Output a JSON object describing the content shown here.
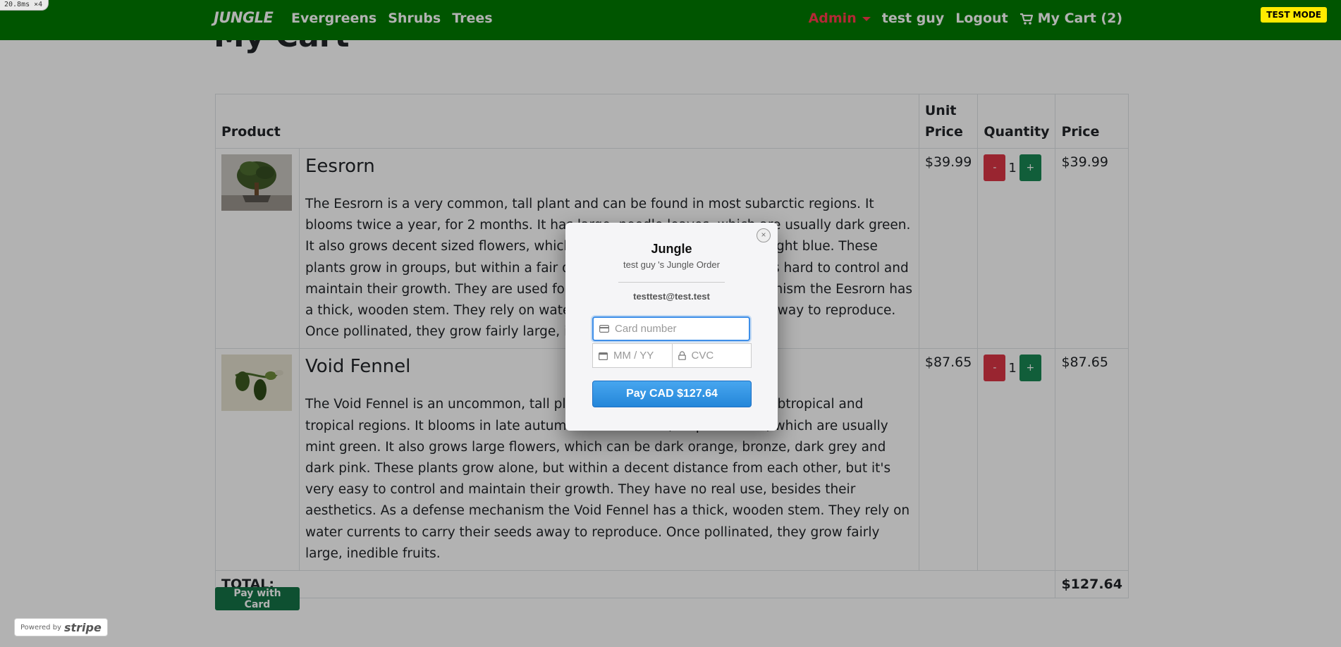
{
  "debug": {
    "perf": "20.8ms ×4"
  },
  "nav": {
    "brand": "JUNGLE",
    "left": [
      "Evergreens",
      "Shrubs",
      "Trees"
    ],
    "admin": "Admin",
    "user": "test guy",
    "logout": "Logout",
    "cart": "My Cart (2)",
    "test_mode": "TEST MODE"
  },
  "page": {
    "title": "My Cart"
  },
  "table": {
    "headers": {
      "product": "Product",
      "unit_price": "Unit Price",
      "quantity": "Quantity",
      "price": "Price"
    },
    "rows": [
      {
        "name": "Eesrorn",
        "description": "The Eesrorn is a very common, tall plant and can be found in most subarctic regions. It blooms twice a year, for 2 months. It has large, needle leaves, which are usually dark green. It also grows decent sized flowers, which can be light grey, yellow and light blue. These plants grow in groups, but within a fair distance from each other, but it's hard to control and maintain their growth. They are used for medicine. As a defense mechanism the Eesrorn has a thick, wooden stem. They rely on water currents to carry their seeds away to reproduce. Once pollinated, they grow fairly large, inedible fruits.",
        "unit_price": "$39.99",
        "quantity": "1",
        "price": "$39.99",
        "minus": "-",
        "plus": "+"
      },
      {
        "name": "Void Fennel",
        "description": "The Void Fennel is an uncommon, tall plant and can be found in most subtropical and tropical regions. It blooms in late autumn. It has narrow, elliptic leaves, which are usually mint green. It also grows large flowers, which can be dark orange, bronze, dark grey and dark pink. These plants grow alone, but within a decent distance from each other, but it's very easy to control and maintain their growth. They have no real use, besides their aesthetics. As a defense mechanism the Void Fennel has a thick, wooden stem. They rely on water currents to carry their seeds away to reproduce. Once pollinated, they grow fairly large, inedible fruits.",
        "unit_price": "$87.65",
        "quantity": "1",
        "price": "$87.65",
        "minus": "-",
        "plus": "+"
      }
    ],
    "total_label": "TOTAL:",
    "total_value": "$127.64"
  },
  "pay_with_card": "Pay with Card",
  "powered_by": {
    "prefix": "Powered by",
    "brand": "stripe"
  },
  "checkout": {
    "title": "Jungle",
    "subtitle": "test guy 's Jungle Order",
    "email": "testtest@test.test",
    "card_placeholder": "Card number",
    "expiry_placeholder": "MM / YY",
    "cvc_placeholder": "CVC",
    "pay_button": "Pay CAD $127.64",
    "close": "×"
  },
  "colors": {
    "navbar": "#007a00",
    "admin": "#ff3b4e",
    "minus_button": "#dc3545",
    "plus_button": "#198754",
    "pay_card_button": "#157347",
    "checkout_button": "#2e8ee0",
    "test_mode": "#ffea00"
  },
  "icons": {
    "cart": "shopping-cart-icon",
    "card": "credit-card-icon",
    "calendar": "calendar-icon",
    "lock": "lock-icon",
    "close": "close-icon"
  }
}
